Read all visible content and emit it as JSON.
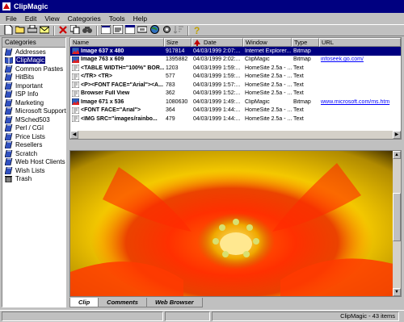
{
  "window": {
    "title": "ClipMagic"
  },
  "menu": [
    "File",
    "Edit",
    "View",
    "Categories",
    "Tools",
    "Help"
  ],
  "toolbar": [
    "new-icon",
    "open-icon",
    "print-icon",
    "mail-icon",
    "sep",
    "delete-icon",
    "copy-icon",
    "find-icon",
    "sep",
    "view-icon",
    "properties-icon",
    "window-icon",
    "capture-icon",
    "web-icon",
    "settings-icon",
    "sort-icon",
    "sep",
    "help-icon"
  ],
  "sidebar": {
    "header": "Categories",
    "items": [
      {
        "label": "Addresses"
      },
      {
        "label": "ClipMagic",
        "selected": true
      },
      {
        "label": "Common Pastes"
      },
      {
        "label": "HitBits"
      },
      {
        "label": "Important"
      },
      {
        "label": "ISP Info"
      },
      {
        "label": "Marketing"
      },
      {
        "label": "Microsoft Support"
      },
      {
        "label": "MSched503"
      },
      {
        "label": "Perl / CGI"
      },
      {
        "label": "Price Lists"
      },
      {
        "label": "Resellers"
      },
      {
        "label": "Scratch"
      },
      {
        "label": "Web Host Clients"
      },
      {
        "label": "Wish Lists"
      },
      {
        "label": "Trash",
        "trash": true
      }
    ]
  },
  "list": {
    "columns": [
      "Name",
      "Size",
      "Date",
      "Window",
      "Type",
      "URL"
    ],
    "rows": [
      {
        "icon": "image",
        "name": "Image 637 x 480",
        "size": "917814",
        "date": "04/03/1999 2:07:...",
        "window": "Internet Explorer...",
        "type": "Bitmap",
        "url": "",
        "selected": true
      },
      {
        "icon": "image",
        "name": "Image 763 x 609",
        "size": "1395882",
        "date": "04/03/1999 2:02:...",
        "window": "ClipMagic",
        "type": "Bitmap",
        "url": "infoseek.go.com/"
      },
      {
        "icon": "text",
        "name": "<TABLE WIDTH=\"100%\" BOR...",
        "size": "1203",
        "date": "04/03/1999 1:59:...",
        "window": "HomeSite 2.5a - ...",
        "type": "Text",
        "url": ""
      },
      {
        "icon": "text",
        "name": "</TR>                <TR>",
        "size": "577",
        "date": "04/03/1999 1:59:...",
        "window": "HomeSite 2.5a - ...",
        "type": "Text",
        "url": ""
      },
      {
        "icon": "text",
        "name": "<P><FONT FACE=\"Arial\"><A...",
        "size": "783",
        "date": "04/03/1999 1:57:...",
        "window": "HomeSite 2.5a - ...",
        "type": "Text",
        "url": ""
      },
      {
        "icon": "text",
        "name": "Browser Full View",
        "size": "362",
        "date": "04/03/1999 1:52:...",
        "window": "HomeSite 2.5a - ...",
        "type": "Text",
        "url": ""
      },
      {
        "icon": "image",
        "name": "Image 671 x 536",
        "size": "1080630",
        "date": "04/03/1999 1:49:...",
        "window": "ClipMagic",
        "type": "Bitmap",
        "url": "www.microsoft.com/ms.htm"
      },
      {
        "icon": "text",
        "name": "<FONT FACE=\"Arial\">",
        "size": "364",
        "date": "04/03/1999 1:44:...",
        "window": "HomeSite 2.5a - ...",
        "type": "Text",
        "url": ""
      },
      {
        "icon": "text",
        "name": "<IMG SRC=\"images/rainbo...",
        "size": "479",
        "date": "04/03/1999 1:44:...",
        "window": "HomeSite 2.5a - ...",
        "type": "Text",
        "url": ""
      }
    ]
  },
  "tabs": [
    {
      "label": "Clip",
      "active": true
    },
    {
      "label": "Comments"
    },
    {
      "label": "Web Browser"
    }
  ],
  "status": {
    "text": "ClipMagic - 43 items"
  }
}
